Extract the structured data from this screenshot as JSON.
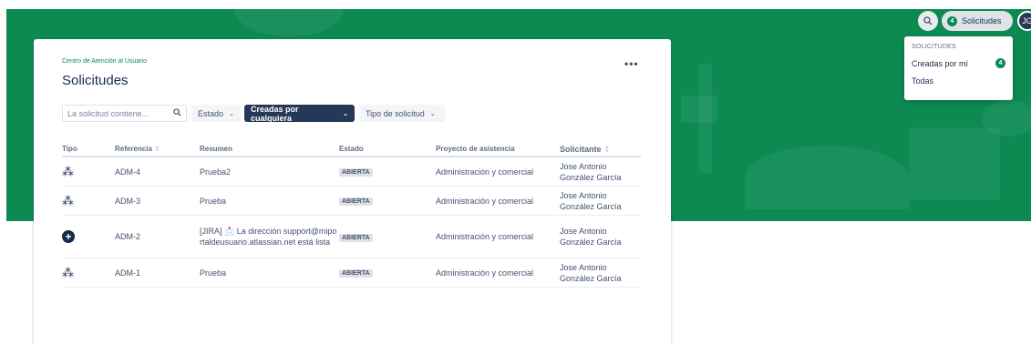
{
  "topbar": {
    "search_icon": "search-icon",
    "requests_label": "Solicitudes",
    "requests_count": "4",
    "avatar_initials": "JG"
  },
  "dropdown": {
    "title": "SOLICITUDES",
    "items": [
      {
        "label": "Creadas por mí",
        "count": "4"
      },
      {
        "label": "Todas"
      }
    ]
  },
  "card": {
    "breadcrumb": "Centro de Atención al Usuario",
    "title": "Solicitudes",
    "more": "•••",
    "search": {
      "placeholder": "La solicitud contiene..."
    },
    "filters": {
      "estado": "Estado",
      "creadas": "Creadas por cualquiera",
      "tipo": "Tipo de solicitud"
    },
    "columns": {
      "tipo": "Tipo",
      "referencia": "Referencia",
      "resumen": "Resumen",
      "estado": "Estado",
      "proyecto": "Proyecto de asistencia",
      "solicitante": "Solicitante"
    },
    "rows": [
      {
        "type_icon": "users-icon",
        "ref": "ADM-4",
        "summary": "Prueba2",
        "status": "ABIERTA",
        "project": "Administración y comercial",
        "requester": "Jose Antonio González García"
      },
      {
        "type_icon": "users-icon",
        "ref": "ADM-3",
        "summary": "Prueba",
        "status": "ABIERTA",
        "project": "Administración y comercial",
        "requester": "Jose Antonio González García"
      },
      {
        "type_icon": "plus-circle-icon",
        "ref": "ADM-2",
        "summary": "[JIRA] 📩 La dirección support@miportaldeusuario.atlassian.net está lista",
        "status": "ABIERTA",
        "project": "Administración y comercial",
        "requester": "Jose Antonio González García"
      },
      {
        "type_icon": "users-icon",
        "ref": "ADM-1",
        "summary": "Prueba",
        "status": "ABIERTA",
        "project": "Administración y comercial",
        "requester": "Jose Antonio González García"
      }
    ]
  },
  "colors": {
    "brand_green": "#0c8a52",
    "nav_dark": "#253858"
  }
}
